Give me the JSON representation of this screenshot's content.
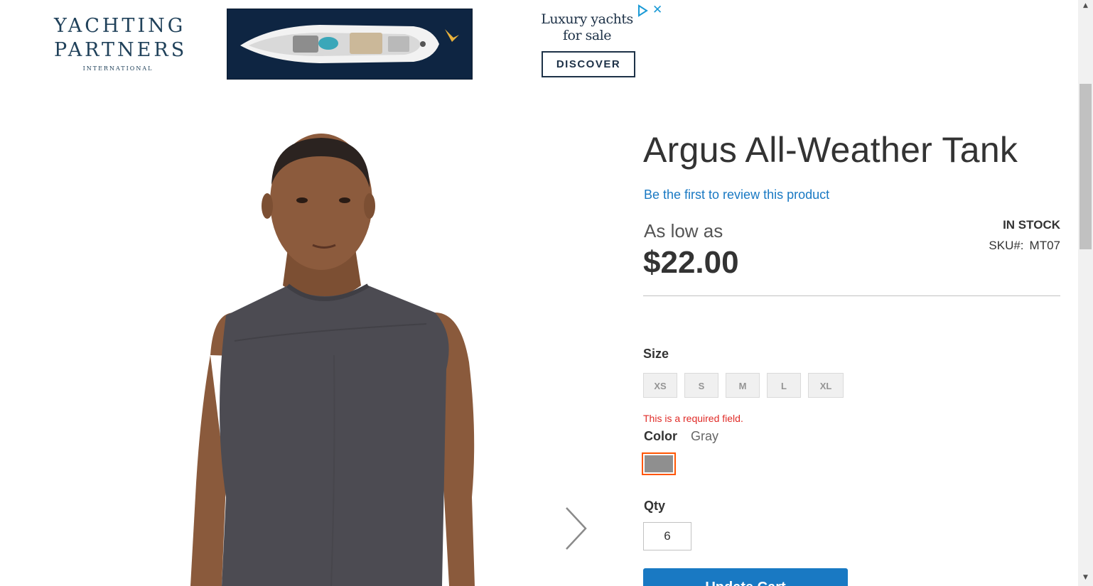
{
  "ad": {
    "brand_line1": "YACHTING",
    "brand_line2": "PARTNERS",
    "brand_line3": "INTERNATIONAL",
    "headline": "Luxury yachts for sale",
    "cta": "DISCOVER",
    "choices_icon": "ad-choices-icon",
    "close_icon": "close-icon",
    "close_glyph": "✕",
    "accent_color": "#1b9ad6",
    "navy_color": "#1d3147"
  },
  "gallery": {
    "next_icon": "chevron-right-icon"
  },
  "product": {
    "title": "Argus All-Weather Tank",
    "review_link": "Be the first to review this product",
    "price_label": "As low as",
    "price": "$22.00",
    "stock": "IN STOCK",
    "sku_label": "SKU#:",
    "sku_value": "MT07",
    "link_color": "#1979c3"
  },
  "options": {
    "size_label": "Size",
    "sizes": [
      "XS",
      "S",
      "M",
      "L",
      "XL"
    ],
    "required_error": "This is a required field.",
    "color_label": "Color",
    "color_value": "Gray",
    "selected_color": "#8f8f8f",
    "selection_border_color": "#ff5501",
    "error_color": "#e02b27"
  },
  "qty": {
    "label": "Qty",
    "value": "6"
  },
  "cart": {
    "button_label": "Update Cart",
    "button_color": "#1979c3"
  },
  "scrollbar": {
    "up_glyph": "▲",
    "down_glyph": "▼"
  }
}
